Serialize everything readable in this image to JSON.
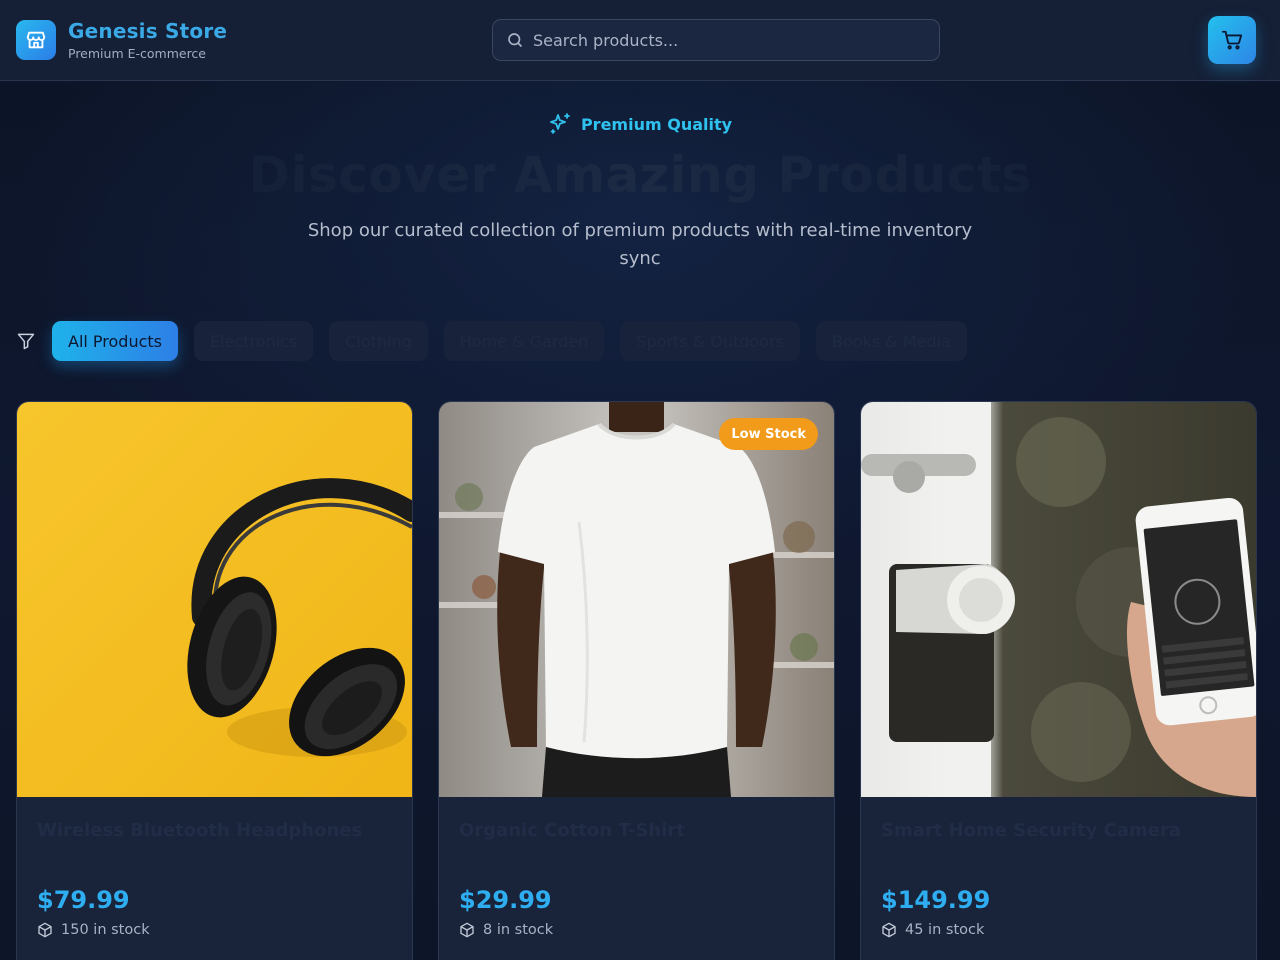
{
  "header": {
    "brand_title": "Genesis Store",
    "brand_subtitle": "Premium E-commerce",
    "search_placeholder": "Search products...",
    "icons": {
      "logo": "store-icon",
      "search": "search-icon",
      "cart": "shopping-cart-icon"
    }
  },
  "hero": {
    "badge": "Premium Quality",
    "badge_icon": "sparkles-icon",
    "title": "Discover Amazing Products",
    "subtitle": "Shop our curated collection of premium products with real-time inventory sync"
  },
  "filters": {
    "icon": "filter-icon",
    "active": "All Products",
    "categories": [
      "All Products",
      "Electronics",
      "Clothing",
      "Home & Garden",
      "Sports & Outdoors",
      "Books & Media"
    ]
  },
  "products": [
    {
      "name": "Wireless Bluetooth Headphones",
      "price": "$79.99",
      "stock": "150 in stock",
      "badge": "",
      "image": "headphones-photo"
    },
    {
      "name": "Organic Cotton T-Shirt",
      "price": "$29.99",
      "stock": "8 in stock",
      "badge": "Low Stock",
      "image": "tshirt-photo"
    },
    {
      "name": "Smart Home Security Camera",
      "price": "$149.99",
      "stock": "45 in stock",
      "badge": "",
      "image": "smart-lock-photo"
    }
  ],
  "colors": {
    "accent": "#2eaef0",
    "brand": "#3aa9e6",
    "low_stock": "#f29a1a",
    "background": "#0d1528"
  }
}
